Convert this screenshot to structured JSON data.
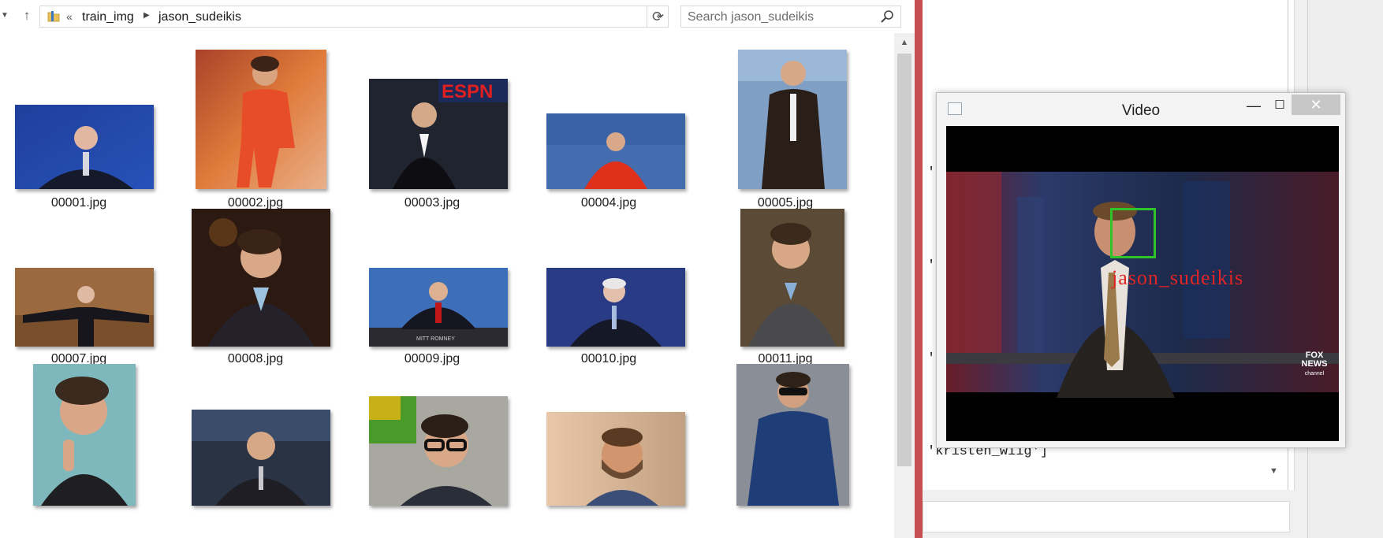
{
  "explorer": {
    "breadcrumb": {
      "overflow": "«",
      "parent": "train_img",
      "current": "jason_sudeikis"
    },
    "search": {
      "placeholder": "Search jason_sudeikis"
    },
    "files": [
      {
        "name": "00001.jpg",
        "thumb": "suited-man-blue-podium"
      },
      {
        "name": "00002.jpg",
        "thumb": "man-red-tracksuit"
      },
      {
        "name": "00003.jpg",
        "thumb": "man-tuxedo-espn"
      },
      {
        "name": "00004.jpg",
        "thumb": "man-red-devil-costume"
      },
      {
        "name": "00005.jpg",
        "thumb": "man-suit-red-carpet"
      },
      {
        "name": "00007.jpg",
        "thumb": "man-arms-wide-stage"
      },
      {
        "name": "00008.jpg",
        "thumb": "man-dark-jacket-portrait"
      },
      {
        "name": "00009.jpg",
        "thumb": "man-news-desk"
      },
      {
        "name": "00010.jpg",
        "thumb": "man-blue-debate-stage"
      },
      {
        "name": "00011.jpg",
        "thumb": "man-smiling-gray-sweater"
      },
      {
        "name": "",
        "thumb": "man-teal-portrait"
      },
      {
        "name": "",
        "thumb": "man-talkshow-chair"
      },
      {
        "name": "",
        "thumb": "man-glasses-green"
      },
      {
        "name": "",
        "thumb": "man-bearded-outdoor"
      },
      {
        "name": "",
        "thumb": "man-sunglasses-blue-shirt"
      }
    ]
  },
  "editor": {
    "lines": [
      "'l",
      "'l",
      "'l",
      "'kristen_wiig']"
    ]
  },
  "video_window": {
    "title": "Video",
    "minimize": "—",
    "maximize": "☐",
    "close": "✕",
    "face_label": "jason_sudeikis",
    "channel_logo": "FOX NEWS",
    "channel_sub": "channel"
  },
  "colors": {
    "accent_red_border": "#c54e52",
    "face_box": "#2ec42a",
    "face_label": "#e12424"
  }
}
